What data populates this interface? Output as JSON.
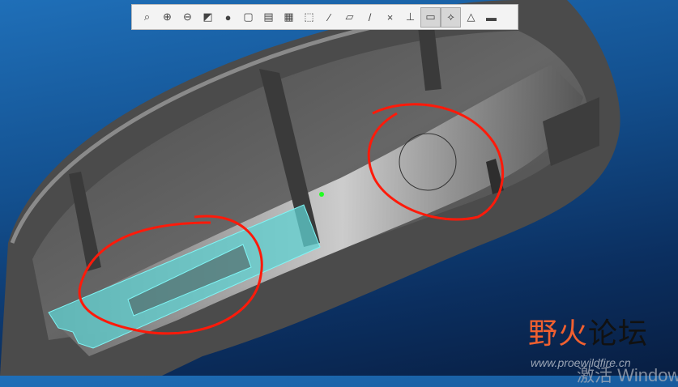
{
  "toolbar": {
    "buttons": [
      {
        "icon": "zoom-fit-icon",
        "glyph": "⌕"
      },
      {
        "icon": "zoom-in-icon",
        "glyph": "⊕"
      },
      {
        "icon": "zoom-out-icon",
        "glyph": "⊖"
      },
      {
        "icon": "repaint-icon",
        "glyph": "◩"
      },
      {
        "icon": "display-style-icon",
        "glyph": "●"
      },
      {
        "icon": "saved-orientations-icon",
        "glyph": "▢"
      },
      {
        "icon": "view-manager-icon",
        "glyph": "▤"
      },
      {
        "icon": "snapshot-icon",
        "glyph": "▦"
      },
      {
        "icon": "perspective-view-icon",
        "glyph": "⬚"
      },
      {
        "icon": "datum-display-icon",
        "glyph": "⁄"
      },
      {
        "icon": "plane-display-icon",
        "glyph": "▱"
      },
      {
        "icon": "axis-display-icon",
        "glyph": "/"
      },
      {
        "icon": "point-display-icon",
        "glyph": "×"
      },
      {
        "icon": "csys-display-icon",
        "glyph": "⊥"
      },
      {
        "icon": "annotation-display-icon",
        "glyph": "▭",
        "active": true
      },
      {
        "icon": "spin-center-icon",
        "glyph": "⟡",
        "active": true
      },
      {
        "icon": "shade-mode-icon",
        "glyph": "△"
      },
      {
        "icon": "render-icon",
        "glyph": "▬"
      }
    ]
  },
  "watermark": {
    "name_part1": "野火",
    "name_part2": "论坛",
    "url": "www.proewildfire.cn"
  },
  "os_overlay": "激活 Windows",
  "colors": {
    "highlight": "#5fe0e0",
    "markup": "#ff1a0a",
    "part": "#555555"
  }
}
